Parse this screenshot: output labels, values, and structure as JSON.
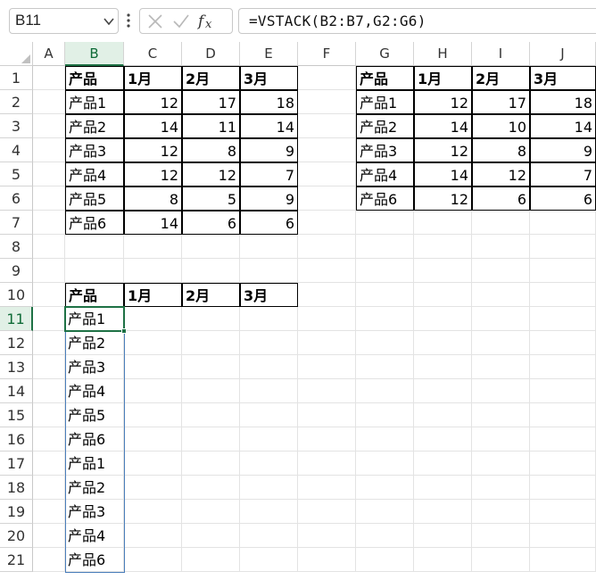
{
  "formula_bar": {
    "name_box": "B11",
    "formula": "=VSTACK(B2:B7,G2:G6)",
    "icons": [
      "chevron-down-icon",
      "more-vertical-icon",
      "cancel-icon",
      "enter-icon",
      "insert-function-icon"
    ]
  },
  "columns": [
    "A",
    "B",
    "C",
    "D",
    "E",
    "F",
    "G",
    "H",
    "I",
    "J"
  ],
  "rows": [
    "1",
    "2",
    "3",
    "4",
    "5",
    "6",
    "7",
    "8",
    "9",
    "10",
    "11",
    "12",
    "13",
    "14",
    "15",
    "16",
    "17",
    "18",
    "19",
    "20",
    "21"
  ],
  "selected_cell": {
    "column": "B",
    "row": "11"
  },
  "table1": {
    "headers": [
      "产品",
      "1月",
      "2月",
      "3月"
    ],
    "rows": [
      [
        "产品1",
        "12",
        "17",
        "18"
      ],
      [
        "产品2",
        "14",
        "11",
        "14"
      ],
      [
        "产品3",
        "12",
        "8",
        "9"
      ],
      [
        "产品4",
        "12",
        "12",
        "7"
      ],
      [
        "产品5",
        "8",
        "5",
        "9"
      ],
      [
        "产品6",
        "14",
        "6",
        "6"
      ]
    ]
  },
  "table2": {
    "headers": [
      "产品",
      "1月",
      "2月",
      "3月"
    ],
    "rows": [
      [
        "产品1",
        "12",
        "17",
        "18"
      ],
      [
        "产品2",
        "14",
        "10",
        "14"
      ],
      [
        "产品3",
        "12",
        "8",
        "9"
      ],
      [
        "产品4",
        "14",
        "12",
        "7"
      ],
      [
        "产品6",
        "12",
        "6",
        "6"
      ]
    ]
  },
  "result_table": {
    "headers": [
      "产品",
      "1月",
      "2月",
      "3月"
    ],
    "spill": [
      "产品1",
      "产品2",
      "产品3",
      "产品4",
      "产品5",
      "产品6",
      "产品1",
      "产品2",
      "产品3",
      "产品4",
      "产品6"
    ]
  },
  "colors": {
    "accent": "#1e7145",
    "spill_border": "#4a7ebb",
    "header_highlight": "#e1f0e6"
  }
}
